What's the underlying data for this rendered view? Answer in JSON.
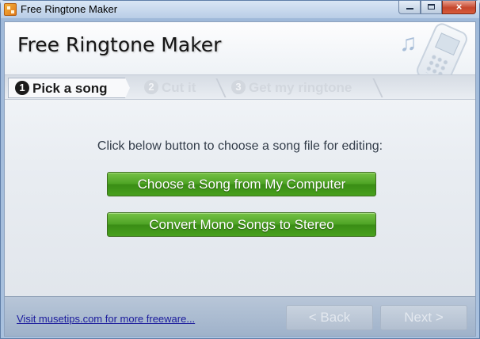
{
  "window": {
    "title": "Free Ringtone Maker",
    "controls": {
      "minimize_icon": "minimize-icon",
      "maximize_icon": "maximize-icon",
      "close_icon": "close-icon",
      "close_glyph": "×"
    }
  },
  "header": {
    "app_title": "Free Ringtone Maker",
    "note_glyph": "♫",
    "decor_icons": [
      "music-note-icon",
      "phone-icon"
    ]
  },
  "steps": [
    {
      "number": "1",
      "label": "Pick a song",
      "state": "active"
    },
    {
      "number": "2",
      "label": "Cut it",
      "state": "inactive"
    },
    {
      "number": "3",
      "label": "Get my ringtone",
      "state": "inactive"
    }
  ],
  "main": {
    "instruction": "Click below button to choose a song file for editing:",
    "buttons": {
      "choose_song": "Choose a Song from My Computer",
      "convert_mono": "Convert Mono Songs to Stereo"
    }
  },
  "footer": {
    "link_text": "Visit musetips.com for more freeware...",
    "back_label": "< Back",
    "next_label": "Next >"
  },
  "colors": {
    "accent_green": "#4ea425",
    "link_blue": "#1a1a9c",
    "disabled_text": "#e3e8ef"
  }
}
